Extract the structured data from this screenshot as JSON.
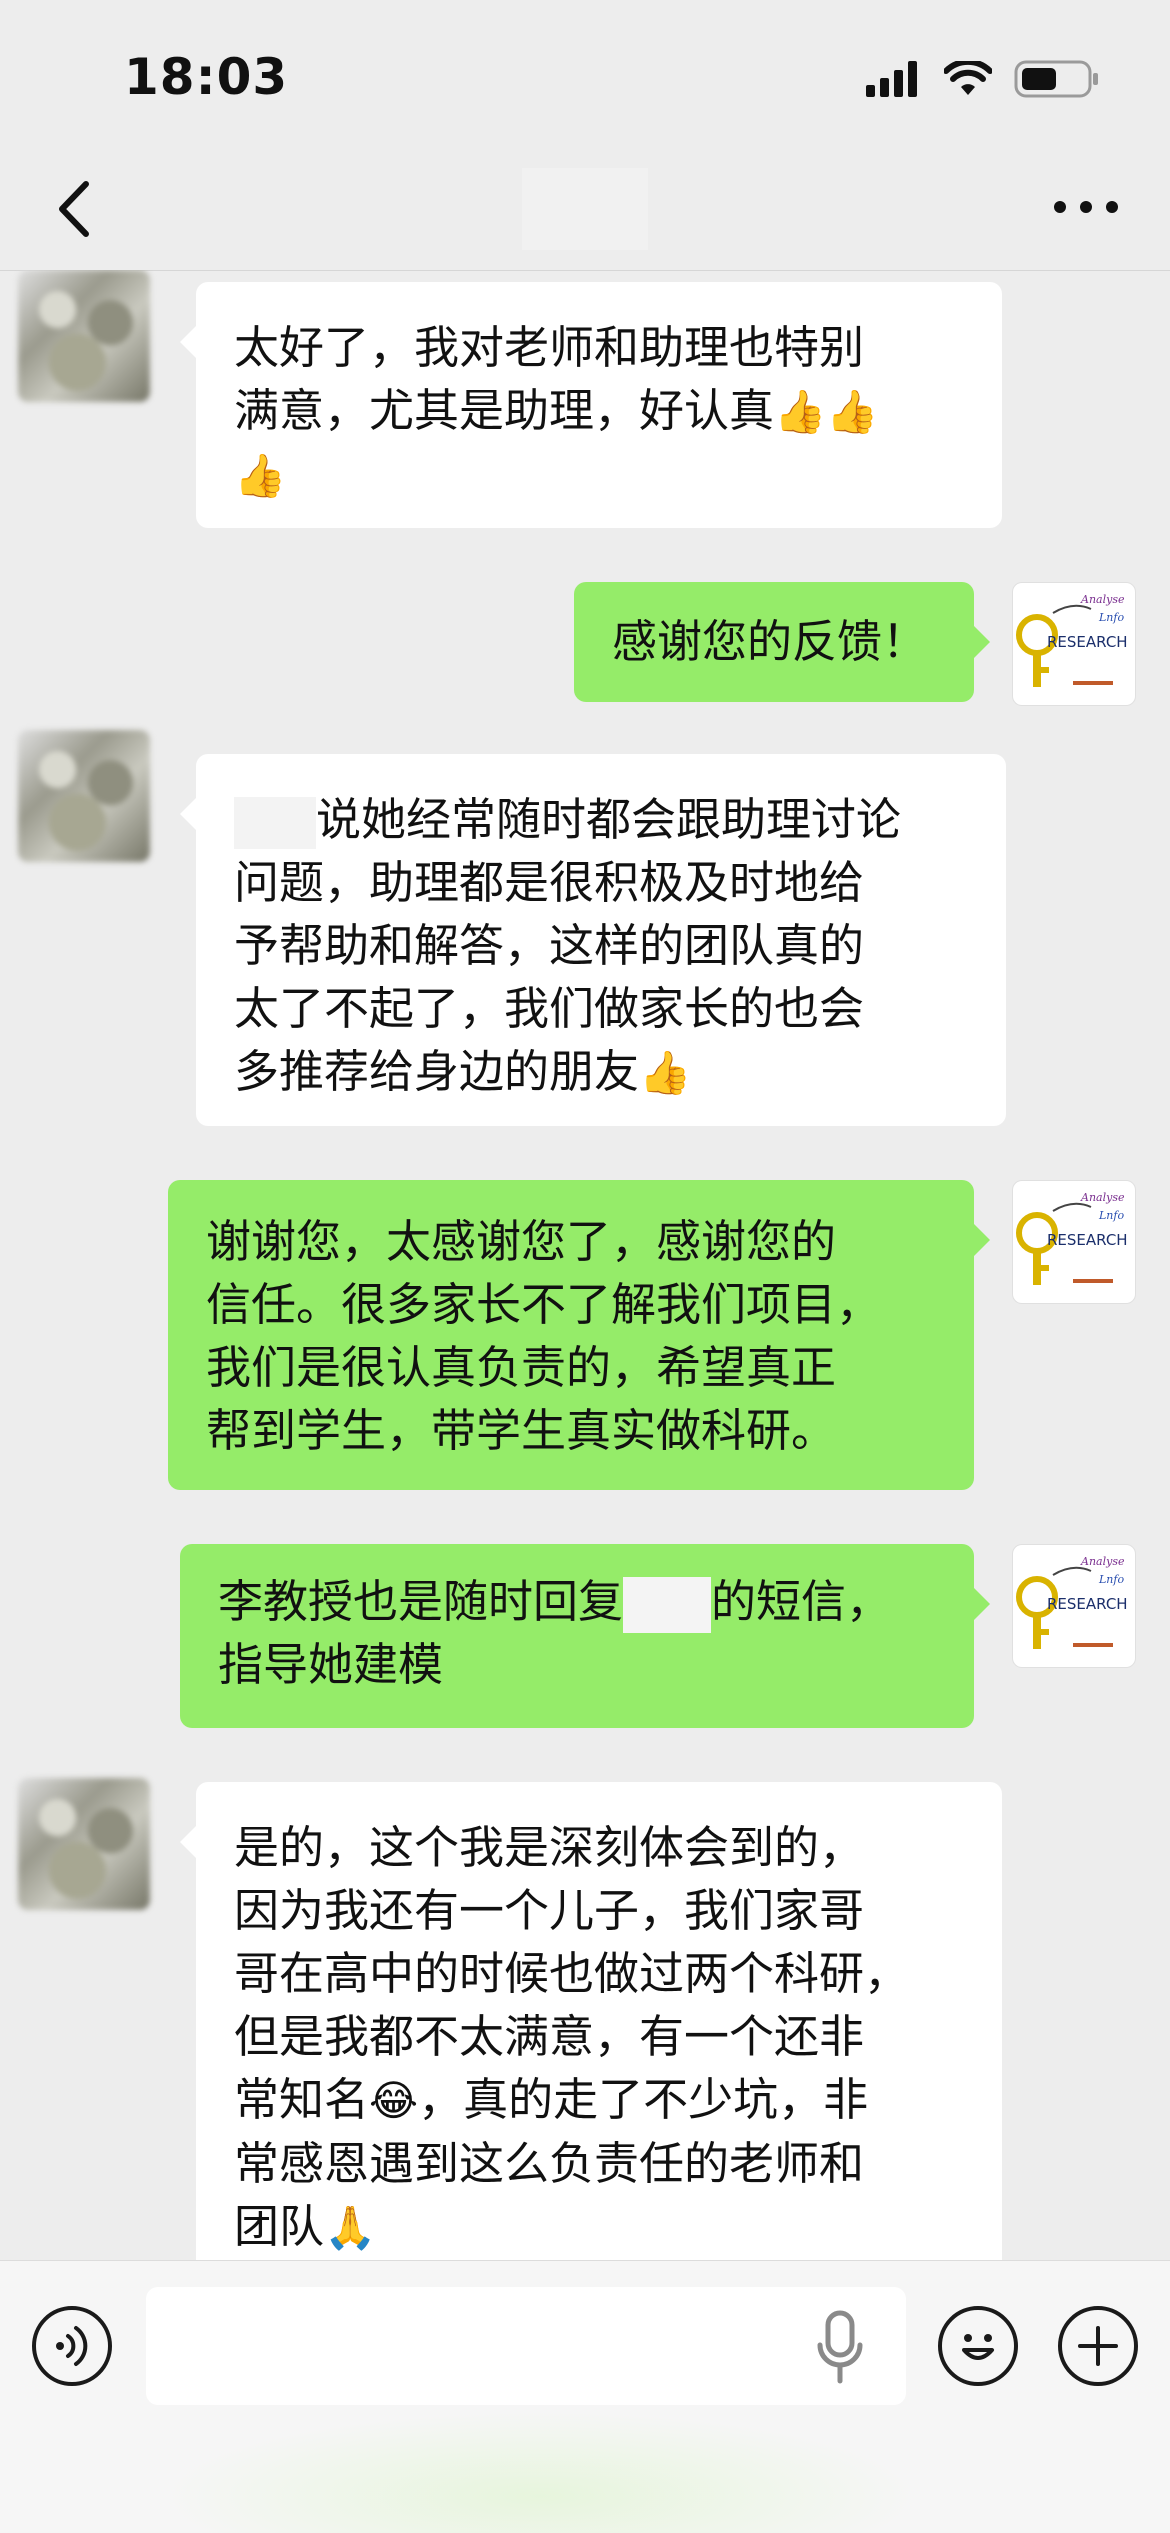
{
  "status_bar": {
    "time": "18:03"
  },
  "icons": {
    "back": "chevron-left-icon",
    "more": "more-horizontal-icon",
    "signal": "signal-icon",
    "wifi": "wifi-icon",
    "battery": "battery-icon",
    "voice": "voice-input-icon",
    "mic": "microphone-icon",
    "emoji": "emoji-icon",
    "plus": "plus-icon"
  },
  "colors": {
    "sent_bubble": "#95ec69",
    "received_bubble": "#ffffff",
    "background": "#ededed"
  },
  "messages": [
    {
      "sender": "contact",
      "lines": [
        "太好了，我对老师和助理也特别",
        "满意，尤其是助理，好认真"
      ]
    },
    {
      "sender": "me",
      "text": "感谢您的反馈！"
    },
    {
      "sender": "contact",
      "lines": [
        "说她经常随时都会跟助理讨论",
        "问题，助理都是很积极及时地给",
        "予帮助和解答，这样的团队真的",
        "太了不起了，我们做家长的也会",
        "多推荐给身边的朋友"
      ]
    },
    {
      "sender": "me",
      "lines": [
        "谢谢您，太感谢您了，感谢您的",
        "信任。很多家长不了解我们项目，",
        "我们是很认真负责的，希望真正",
        "帮到学生，带学生真实做科研。"
      ]
    },
    {
      "sender": "me",
      "lines": [
        "李教授也是随时回复",
        "的短信，",
        "指导她建模"
      ]
    },
    {
      "sender": "contact",
      "lines": [
        "是的，这个我是深刻体会到的，",
        "因为我还有一个儿子，我们家哥",
        "哥在高中的时候也做过两个科研，",
        "但是我都不太满意，有一个还非",
        "常知名",
        "，真的走了不少坑，非",
        "常感恩遇到这么负责任的老师和",
        "团队"
      ]
    }
  ],
  "avatar_label": "RESEARCH",
  "avatar_small_text": "Analyse",
  "avatar_small_text2": "Lnfo",
  "input": {
    "placeholder": ""
  }
}
